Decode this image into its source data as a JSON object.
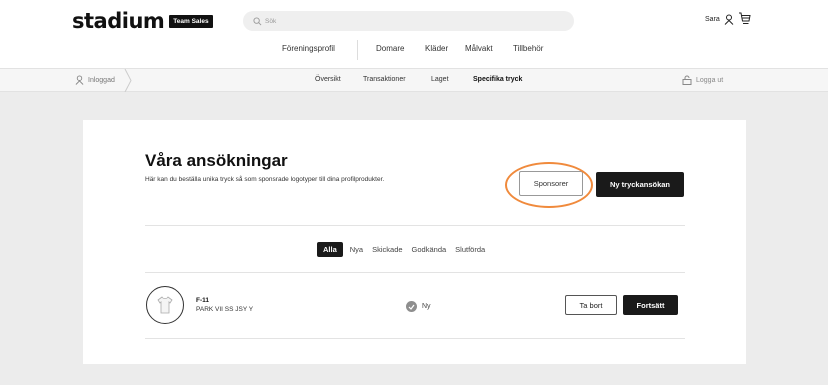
{
  "header": {
    "logo_text": "stadium",
    "logo_badge": "Team Sales",
    "search_placeholder": "Sök",
    "user_name": "Sara",
    "nav": [
      "Föreningsprofil",
      "Domare",
      "Kläder",
      "Målvakt",
      "Tillbehör"
    ]
  },
  "subbar": {
    "login_status": "Inloggad",
    "tabs": [
      "Översikt",
      "Transaktioner",
      "Laget",
      "Specifika tryck"
    ],
    "active_tab": "Specifika tryck",
    "logout": "Logga ut"
  },
  "main": {
    "title": "Våra ansökningar",
    "subtitle": "Här kan du beställa unika tryck så som sponsrade logotyper till dina profilprodukter.",
    "sponsors_button": "Sponsorer",
    "new_request_button": "Ny tryckansökan",
    "highlight_color": "#f08a3c",
    "filters": [
      "Alla",
      "Nya",
      "Skickade",
      "Godkända",
      "Slutförda"
    ],
    "active_filter": "Alla",
    "rows": [
      {
        "code": "F-11",
        "product": "PARK VII SS JSY Y",
        "status": "Ny",
        "remove_label": "Ta bort",
        "continue_label": "Fortsätt"
      }
    ]
  }
}
